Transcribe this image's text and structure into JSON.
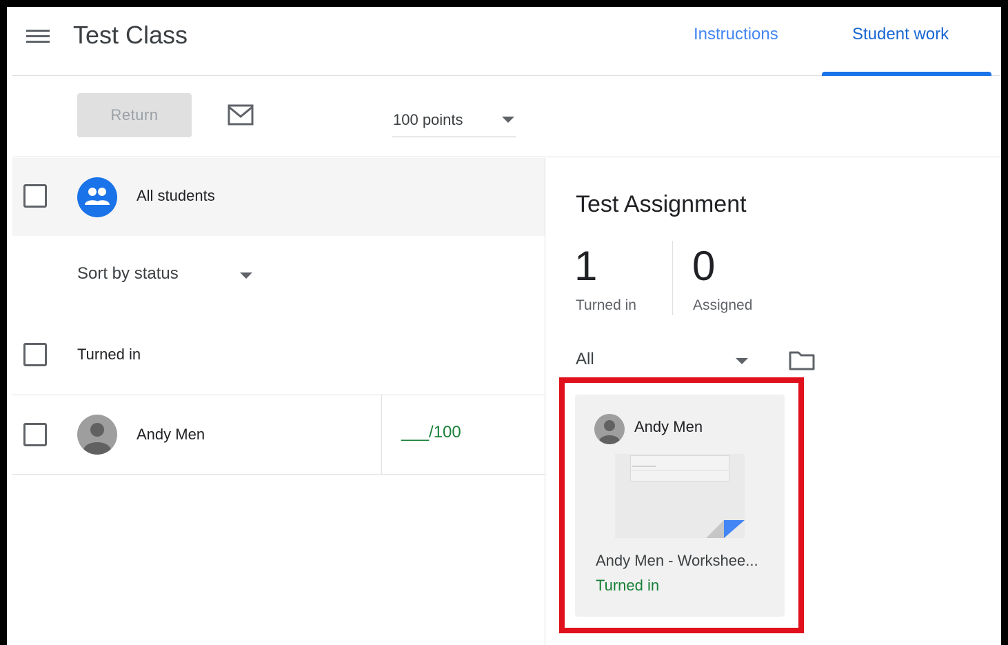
{
  "header": {
    "class_title": "Test Class",
    "tabs": [
      {
        "label": "Instructions",
        "active": false
      },
      {
        "label": "Student work",
        "active": true
      }
    ]
  },
  "toolbar": {
    "return_label": "Return",
    "points_value": "100 points"
  },
  "student_list": {
    "all_students_label": "All students",
    "sort_label": "Sort by status",
    "group_heading": "Turned in",
    "students": [
      {
        "name": "Andy Men",
        "grade": "___/100"
      }
    ]
  },
  "assignment": {
    "title": "Test Assignment",
    "stats": [
      {
        "value": "1",
        "label": "Turned in"
      },
      {
        "value": "0",
        "label": "Assigned"
      }
    ],
    "filter_value": "All",
    "submissions": [
      {
        "student": "Andy Men",
        "file_title": "Andy Men - Workshee...",
        "status": "Turned in"
      }
    ]
  },
  "colors": {
    "accent": "#1a73e8",
    "turned_in_green": "#188038",
    "highlight_red": "#e0101c"
  },
  "icons": [
    "menu-icon",
    "mail-icon",
    "people-icon",
    "person-icon",
    "folder-icon",
    "chevron-down-icon"
  ]
}
